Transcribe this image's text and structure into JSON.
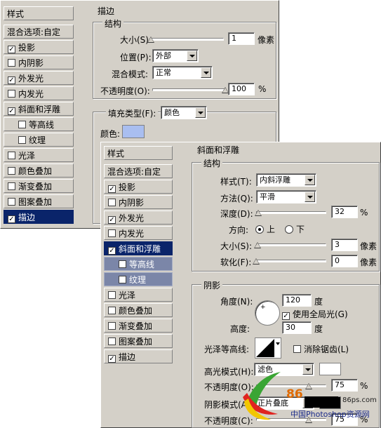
{
  "back_panel": {
    "styles_header": "样式",
    "blend_options": "混合选项:自定",
    "items": [
      {
        "label": "投影",
        "checked": true
      },
      {
        "label": "内阴影",
        "checked": false
      },
      {
        "label": "外发光",
        "checked": true
      },
      {
        "label": "内发光",
        "checked": false
      },
      {
        "label": "斜面和浮雕",
        "checked": true
      },
      {
        "label": "等高线",
        "checked": false
      },
      {
        "label": "纹理",
        "checked": false
      },
      {
        "label": "光泽",
        "checked": false
      },
      {
        "label": "颜色叠加",
        "checked": false
      },
      {
        "label": "渐变叠加",
        "checked": false
      },
      {
        "label": "图案叠加",
        "checked": false
      },
      {
        "label": "描边",
        "checked": true
      }
    ],
    "stroke": {
      "title": "描边",
      "structure_title": "结构",
      "size_label": "大小(S):",
      "size_value": "1",
      "size_unit": "像素",
      "size_slider": 0.0,
      "position_label": "位置(P):",
      "position_value": "外部",
      "blend_label": "混合模式:",
      "blend_value": "正常",
      "opacity_label": "不透明度(O):",
      "opacity_value": "100",
      "opacity_unit": "%",
      "opacity_slider": 1.0,
      "fill_type_label": "填充类型(F):",
      "fill_type_value": "颜色",
      "color_label": "颜色:",
      "color": "#a9bef0"
    }
  },
  "front_panel": {
    "styles_header": "样式",
    "blend_options": "混合选项:自定",
    "items": [
      {
        "label": "投影",
        "checked": true
      },
      {
        "label": "内阴影",
        "checked": false
      },
      {
        "label": "外发光",
        "checked": true
      },
      {
        "label": "内发光",
        "checked": false
      },
      {
        "label": "斜面和浮雕",
        "checked": true
      },
      {
        "label": "等高线",
        "checked": false
      },
      {
        "label": "纹理",
        "checked": false
      },
      {
        "label": "光泽",
        "checked": false
      },
      {
        "label": "颜色叠加",
        "checked": false
      },
      {
        "label": "渐变叠加",
        "checked": false
      },
      {
        "label": "图案叠加",
        "checked": false
      },
      {
        "label": "描边",
        "checked": true
      }
    ],
    "bevel": {
      "title": "斜面和浮雕",
      "structure_title": "结构",
      "style_label": "样式(T):",
      "style_value": "内斜浮雕",
      "method_label": "方法(Q):",
      "method_value": "平滑",
      "depth_label": "深度(D):",
      "depth_value": "32",
      "depth_unit": "%",
      "depth_slider": 0.03,
      "direction_label": "方向:",
      "dir_up": "上",
      "dir_down": "下",
      "size_label": "大小(S):",
      "size_value": "3",
      "size_unit": "像素",
      "size_slider": 0.02,
      "soften_label": "软化(F):",
      "soften_value": "0",
      "soften_unit": "像素",
      "soften_slider": 0.0,
      "shading_title": "阴影",
      "angle_label": "角度(N):",
      "angle_value": "120",
      "angle_unit": "度",
      "global_light_label": "使用全局光(G)",
      "altitude_label": "高度:",
      "altitude_value": "30",
      "altitude_unit": "度",
      "gloss_label": "光泽等高线:",
      "antialias_label": "消除锯齿(L)",
      "highlight_label": "高光模式(H):",
      "highlight_value": "滤色",
      "highlight_color": "#ffffff",
      "hl_opacity_label": "不透明度(O):",
      "hl_opacity_value": "75",
      "hl_opacity_unit": "%",
      "hl_opacity_slider": 0.75,
      "shadow_mode_label": "阴影模式(A):",
      "shadow_mode_value": "正片叠底",
      "shadow_color": "#000000",
      "sh_opacity_label": "不透明度(C):",
      "sh_opacity_value": "75",
      "sh_opacity_unit": "%",
      "sh_opacity_slider": 0.75
    },
    "watermark": {
      "site": "86ps.com",
      "brand": "86",
      "text": "中国Photoshop资源网"
    }
  }
}
